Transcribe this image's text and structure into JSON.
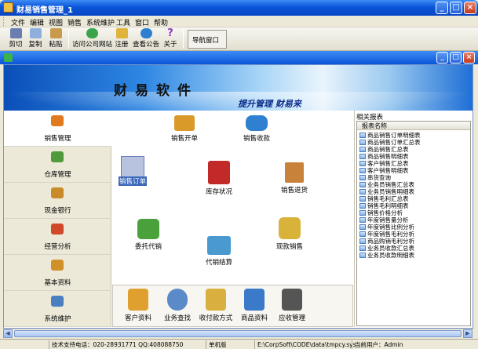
{
  "window": {
    "title": "财易销售管理_1",
    "minimize": "_",
    "maximize": "□",
    "close": "×"
  },
  "menu": {
    "items": [
      "文件",
      "编辑",
      "视图",
      "销售",
      "系统维护",
      "工具",
      "窗口",
      "帮助"
    ]
  },
  "toolbar": {
    "buttons": [
      {
        "label": "剪切",
        "icon": "scissors-icon",
        "color": "#6a7fb0"
      },
      {
        "label": "复制",
        "icon": "copy-icon",
        "color": "#8fb0dc"
      },
      {
        "label": "粘贴",
        "icon": "paste-icon",
        "color": "#c99a4b"
      },
      {
        "label": "访问公司网站",
        "icon": "globe-icon",
        "color": "#3aa44a"
      },
      {
        "label": "注册",
        "icon": "register-icon",
        "color": "#e0b33a"
      },
      {
        "label": "查看公告",
        "icon": "earth-icon",
        "color": "#2f7fd0"
      },
      {
        "label": "关于",
        "icon": "question-icon",
        "color": "#8a3fc0"
      }
    ],
    "nav_window": "导航窗口"
  },
  "mdi": {
    "minimize": "_",
    "maximize": "□",
    "close": "×"
  },
  "banner": {
    "title": "财易软件",
    "slogan": "提升管理 财易来"
  },
  "left_nav": {
    "items": [
      {
        "label": "销售管理",
        "icon": "sales-icon",
        "color": "#e07a1e",
        "selected": true
      },
      {
        "label": "仓库管理",
        "icon": "warehouse-icon",
        "color": "#4f9a3c",
        "selected": false
      },
      {
        "label": "现金银行",
        "icon": "bank-icon",
        "color": "#c98a2a",
        "selected": false
      },
      {
        "label": "经营分析",
        "icon": "chart-icon",
        "color": "#d04a2a",
        "selected": false
      },
      {
        "label": "基本资料",
        "icon": "basic-data-icon",
        "color": "#d0902a",
        "selected": false
      },
      {
        "label": "系统维护",
        "icon": "tools-icon",
        "color": "#4a80c0",
        "selected": false
      }
    ]
  },
  "center": {
    "features": [
      {
        "label": "销售开单",
        "icon": "sales-order-icon",
        "color": "#d99a2a"
      },
      {
        "label": "销售收款",
        "icon": "sales-receipt-icon",
        "color": "#2f80d0"
      },
      {
        "label": "销售订单",
        "icon": "sales-order-doc-icon",
        "color": "#6c7fb8"
      },
      {
        "label": "库存状况",
        "icon": "inventory-icon",
        "color": "#c22a2a"
      },
      {
        "label": "销售退货",
        "icon": "sales-return-icon",
        "color": "#c9823a"
      },
      {
        "label": "委托代销",
        "icon": "consignment-icon",
        "color": "#4aa03a"
      },
      {
        "label": "现款销售",
        "icon": "cash-sales-icon",
        "color": "#d9b23a"
      },
      {
        "label": "代销结算",
        "icon": "consignment-settle-icon",
        "color": "#4a9ad0"
      }
    ],
    "bottom_tools": [
      {
        "label": "客户资料",
        "icon": "customer-icon",
        "color": "#e0a030"
      },
      {
        "label": "业务查找",
        "icon": "search-icon",
        "color": "#5a8ac8"
      },
      {
        "label": "收付款方式",
        "icon": "payment-icon",
        "color": "#d9b040"
      },
      {
        "label": "商品资料",
        "icon": "product-icon",
        "color": "#3a7ac8"
      },
      {
        "label": "应收管理",
        "icon": "receivable-icon",
        "color": "#555555"
      }
    ]
  },
  "reports": {
    "title": "相关报表",
    "header": "报表名称",
    "items": [
      "商品销售订单明细表",
      "商品销售订单汇总表",
      "商品销售汇总表",
      "商品销售明细表",
      "客户销售汇总表",
      "客户销售明细表",
      "串货查询",
      "业务员销售汇总表",
      "业务员销售明细表",
      "销售毛利汇总表",
      "销售毛利明细表",
      "销售价格分析",
      "年度销售量分析",
      "年度销售比例分析",
      "年度销售毛利分析",
      "商品购销毛利分析",
      "业务员收款汇总表",
      "业务员收款明细表"
    ]
  },
  "status": {
    "support": "技术支持电话：020-28931771 QQ:408088750",
    "mode": "单机版",
    "path": "E:\\CorpSoft\\CODE\\data\\tmpcy.sys",
    "user": "当前用户：Admin"
  }
}
